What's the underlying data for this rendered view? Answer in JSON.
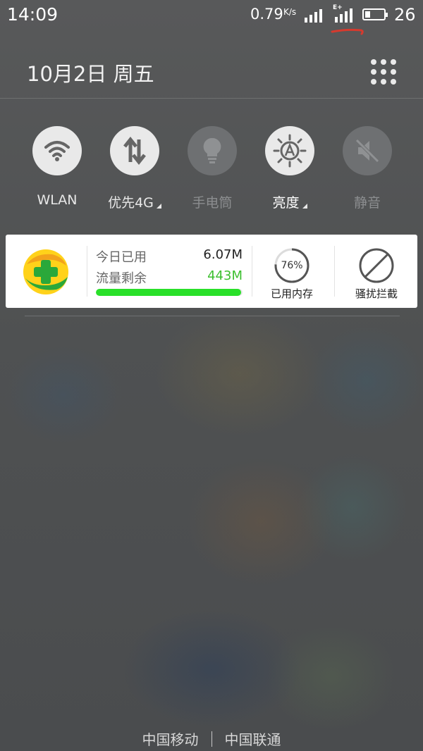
{
  "status_bar": {
    "time": "14:09",
    "net_speed": "0.79",
    "net_unit": "K/s",
    "network_type": "E+",
    "battery_level": 26,
    "battery_text": "26"
  },
  "header": {
    "date": "10月2日  周五",
    "grid_icon": "grid-icon"
  },
  "toggles": [
    {
      "label": "WLAN",
      "icon": "wifi-icon",
      "state": "on"
    },
    {
      "label": "优先4G",
      "icon": "data-arrows-icon",
      "state": "on"
    },
    {
      "label": "手电筒",
      "icon": "flashlight-icon",
      "state": "off"
    },
    {
      "label": "亮度",
      "icon": "brightness-auto-icon",
      "state": "on"
    },
    {
      "label": "静音",
      "icon": "mute-icon",
      "state": "off"
    }
  ],
  "card": {
    "today_used_label": "今日已用",
    "today_used_value": "6.07M",
    "remaining_label": "流量剩余",
    "remaining_value": "443M",
    "data_progress": 0.99,
    "memory_percent_text": "76%",
    "memory_percent": 76,
    "memory_label": "已用内存",
    "block_label": "骚扰拦截"
  },
  "carriers": [
    "中国移动",
    "中国联通"
  ],
  "colors": {
    "accent_green": "#29e029",
    "remaining_green": "#3cbf2f",
    "annotation_red": "#d63a2e"
  }
}
